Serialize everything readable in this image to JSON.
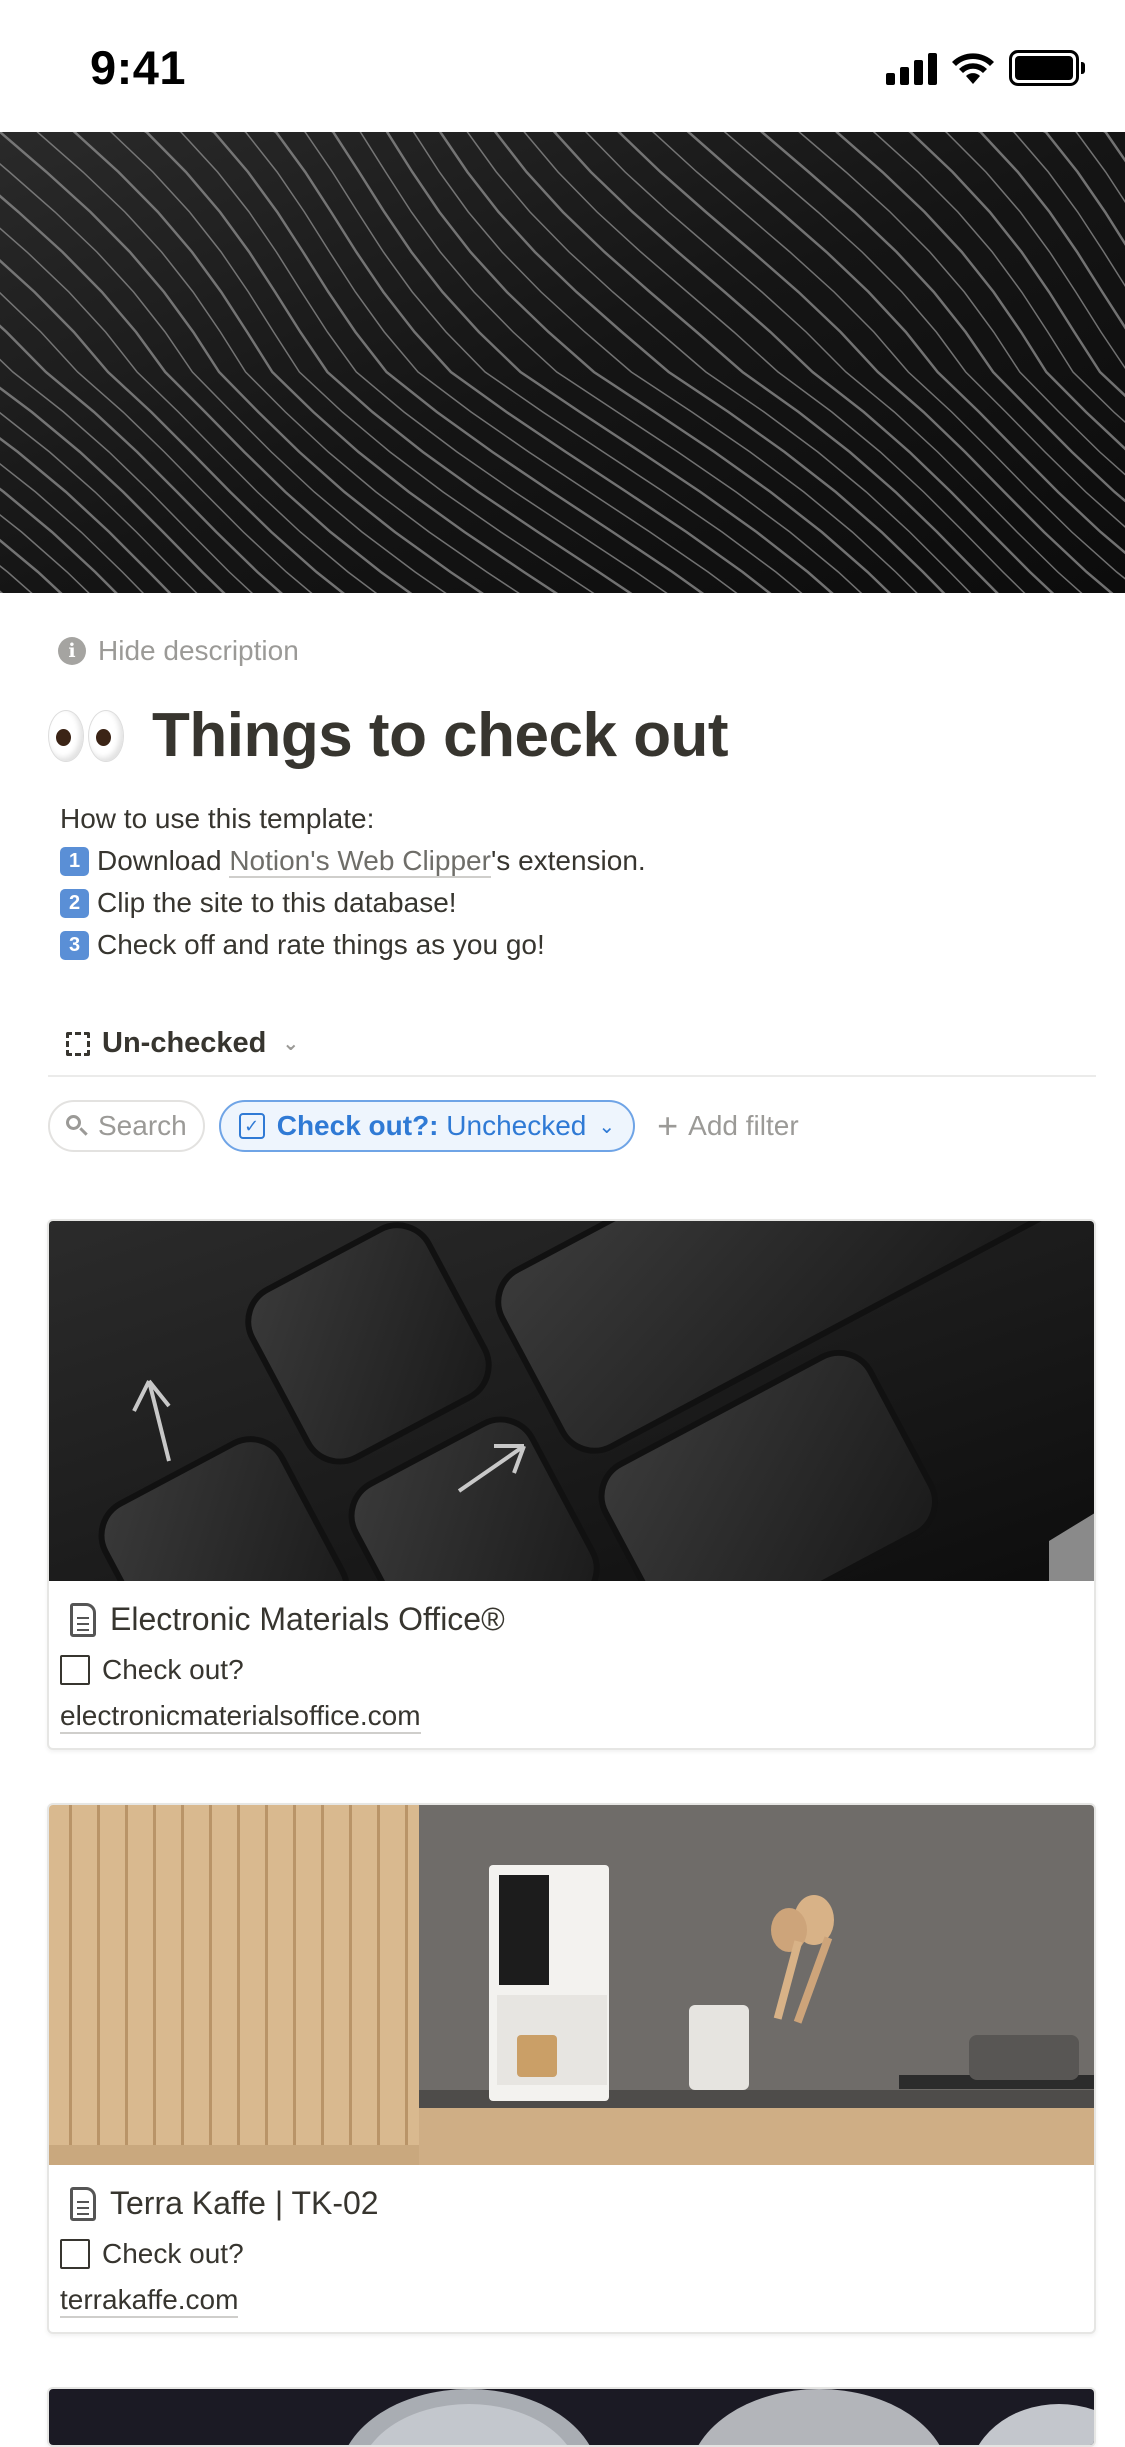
{
  "status_bar": {
    "time": "9:41"
  },
  "hide_description": "Hide description",
  "page": {
    "title": "Things to check out",
    "description": {
      "intro": "How to use this template:",
      "steps": [
        {
          "badge": "1",
          "before": "Download ",
          "link": "Notion's Web Clipper",
          "after": "'s extension."
        },
        {
          "badge": "2",
          "text": "Clip the site to this database!"
        },
        {
          "badge": "3",
          "text": "Check off and rate things as you go!"
        }
      ]
    }
  },
  "view": {
    "name": "Un-checked"
  },
  "filters": {
    "search_label": "Search",
    "active_filter_property": "Check out?:",
    "active_filter_value": "Unchecked",
    "add_filter_label": "Add filter"
  },
  "cards": [
    {
      "title": "Electronic Materials Office®",
      "checkbox_label": "Check out?",
      "checked": false,
      "url": "electronicmaterialsoffice.com"
    },
    {
      "title": "Terra Kaffe | TK-02",
      "checkbox_label": "Check out?",
      "checked": false,
      "url": "terrakaffe.com"
    }
  ],
  "colors": {
    "accent": "#2f7ad5",
    "text": "#37352f",
    "muted": "#9b9a97"
  }
}
